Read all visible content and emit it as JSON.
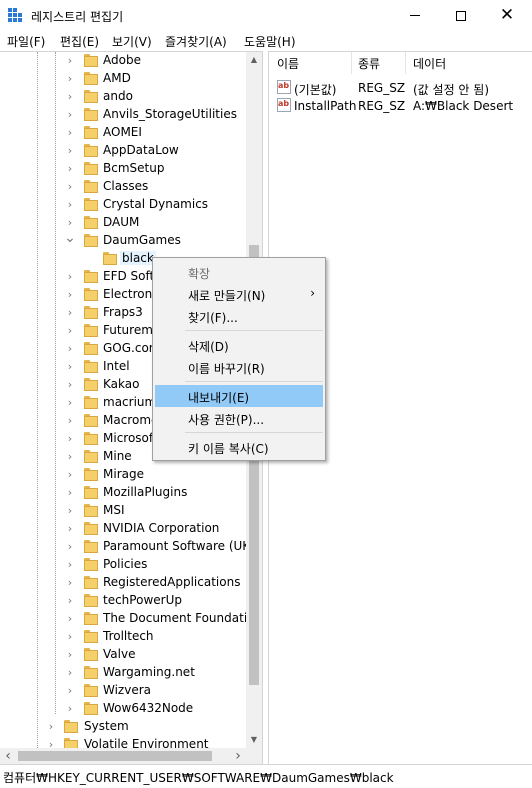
{
  "window": {
    "title": "레지스트리 편집기",
    "close_glyph": "✕"
  },
  "menubar": {
    "items": [
      "파일(F)",
      "편집(E)",
      "보기(V)",
      "즐겨찾기(A)",
      "도움말(H)"
    ]
  },
  "tree": {
    "items": [
      {
        "label": "Adobe",
        "expanded": false
      },
      {
        "label": "AMD",
        "expanded": false
      },
      {
        "label": "ando",
        "expanded": false
      },
      {
        "label": "Anvils_StorageUtilities",
        "expanded": false
      },
      {
        "label": "AOMEI",
        "expanded": false
      },
      {
        "label": "AppDataLow",
        "expanded": false
      },
      {
        "label": "BcmSetup",
        "expanded": false
      },
      {
        "label": "Classes",
        "expanded": false
      },
      {
        "label": "Crystal Dynamics",
        "expanded": false
      },
      {
        "label": "DAUM",
        "expanded": false
      },
      {
        "label": "DaumGames",
        "expanded": true
      },
      {
        "label": "black",
        "child": true,
        "selected": true
      },
      {
        "label": "EFD Soft",
        "expanded": false
      },
      {
        "label": "Electronic",
        "expanded": false
      },
      {
        "label": "Fraps3",
        "expanded": false
      },
      {
        "label": "Futurema",
        "expanded": false
      },
      {
        "label": "GOG.com",
        "expanded": false
      },
      {
        "label": "Intel",
        "expanded": false
      },
      {
        "label": "Kakao",
        "expanded": false
      },
      {
        "label": "macrium",
        "expanded": false
      },
      {
        "label": "Macrome",
        "expanded": false
      },
      {
        "label": "Microsof",
        "expanded": false
      },
      {
        "label": "Mine",
        "expanded": false
      },
      {
        "label": "Mirage",
        "expanded": false
      },
      {
        "label": "MozillaPlugins",
        "expanded": false
      },
      {
        "label": "MSI",
        "expanded": false
      },
      {
        "label": "NVIDIA Corporation",
        "expanded": false
      },
      {
        "label": "Paramount Software (UK) L",
        "expanded": false
      },
      {
        "label": "Policies",
        "expanded": false
      },
      {
        "label": "RegisteredApplications",
        "expanded": false
      },
      {
        "label": "techPowerUp",
        "expanded": false
      },
      {
        "label": "The Document Foundation",
        "expanded": false
      },
      {
        "label": "Trolltech",
        "expanded": false
      },
      {
        "label": "Valve",
        "expanded": false
      },
      {
        "label": "Wargaming.net",
        "expanded": false
      },
      {
        "label": "Wizvera",
        "expanded": false
      },
      {
        "label": "Wow6432Node",
        "expanded": false
      },
      {
        "label": "System",
        "expanded": false,
        "level": "root"
      },
      {
        "label": "Volatile Environment",
        "expanded": false,
        "level": "root"
      }
    ],
    "arrow_up": "▲",
    "arrow_down": "▼",
    "arrow_left": "‹",
    "arrow_right": "›"
  },
  "list": {
    "columns": [
      "이름",
      "종류",
      "데이터"
    ],
    "rows": [
      {
        "name": "(기본값)",
        "type": "REG_SZ",
        "data": "(값 설정 안 됨)",
        "icon": "string-value-icon"
      },
      {
        "name": "InstallPath",
        "type": "REG_SZ",
        "data": "A:₩Black Desert",
        "icon": "string-value-icon"
      }
    ],
    "icon_text": "ab"
  },
  "context_menu": {
    "items": [
      {
        "label": "확장",
        "disabled": true
      },
      {
        "label": "새로 만들기(N)",
        "submenu": true
      },
      {
        "label": "찾기(F)..."
      },
      {
        "separator": true
      },
      {
        "label": "삭제(D)"
      },
      {
        "label": "이름 바꾸기(R)"
      },
      {
        "separator": true
      },
      {
        "label": "내보내기(E)",
        "highlighted": true
      },
      {
        "label": "사용 권한(P)..."
      },
      {
        "separator": true
      },
      {
        "label": "키 이름 복사(C)"
      }
    ],
    "submenu_arrow": "›"
  },
  "statusbar": {
    "path": "컴퓨터₩HKEY_CURRENT_USER₩SOFTWARE₩DaumGames₩black"
  },
  "colors": {
    "highlight": "#91c9f7",
    "folder": "#f4cf6a",
    "selection": "#e5f3ff"
  }
}
